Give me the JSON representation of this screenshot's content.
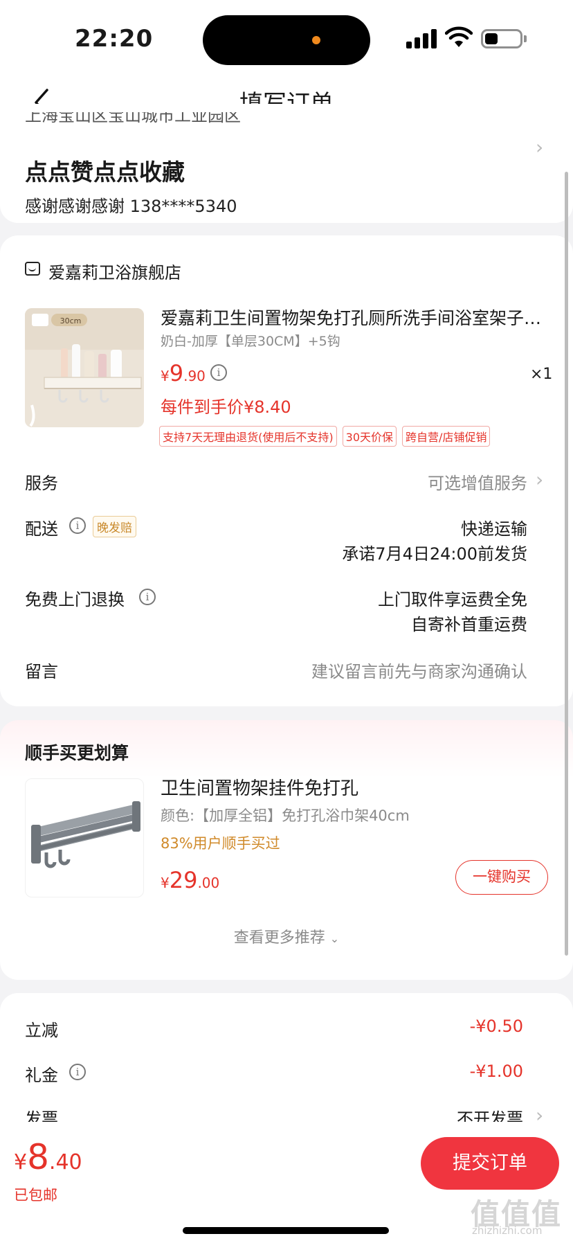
{
  "status_bar": {
    "time": "22:20"
  },
  "nav": {
    "title": "填写订单"
  },
  "address": {
    "line_cut": "上海宝山区宝山城市工业园区",
    "name": "点点赞点点收藏",
    "contact": "感谢感谢感谢  138****5340"
  },
  "shop": {
    "name": "爱嘉莉卫浴旗舰店",
    "product": {
      "thumb_badge": "30cm",
      "title": "爱嘉莉卫生间置物架免打孔厕所洗手间浴室架子…",
      "spec": "奶白-加厚【单层30CM】+5钩",
      "price_currency": "¥",
      "price_int": "9",
      "price_dec": ".90",
      "qty": "×1",
      "per_price": "每件到手价¥8.40",
      "tags": [
        "支持7天无理由退货(使用后不支持)",
        "30天价保",
        "跨自营/店铺促销"
      ]
    },
    "rows": {
      "service_label": "服务",
      "service_value": "可选增值服务",
      "delivery_label": "配送",
      "delivery_badge": "晚发赔",
      "delivery_value_1": "快递运输",
      "delivery_value_2": "承诺7月4日24:00前发货",
      "return_label": "免费上门退换",
      "return_value_1": "上门取件享运费全免",
      "return_value_2": "自寄补首重运费",
      "note_label": "留言",
      "note_placeholder": "建议留言前先与商家沟通确认"
    }
  },
  "recommend": {
    "title": "顺手买更划算",
    "product_name": "卫生间置物架挂件免打孔",
    "spec": "颜色:【加厚全铝】免打孔浴巾架40cm",
    "buyers": "83%用户顺手买过",
    "price_currency": "¥",
    "price_int": "29",
    "price_dec": ".00",
    "buy_button": "一键购买",
    "more": "查看更多推荐"
  },
  "summary": {
    "discount_label": "立减",
    "discount_value": "-¥0.50",
    "gift_label": "礼金",
    "gift_value": "-¥1.00",
    "invoice_label": "发票",
    "invoice_value": "不开发票"
  },
  "bottom": {
    "currency": "¥",
    "total_int": "8",
    "total_dec": ".40",
    "shipping": "已包邮",
    "submit": "提交订单",
    "watermark": "值值值",
    "watermark_url": "zhizhizhi.com"
  },
  "colors": {
    "accent": "#e5332a",
    "submit_bg": "#f0353f",
    "orange": "#d08a2a"
  }
}
